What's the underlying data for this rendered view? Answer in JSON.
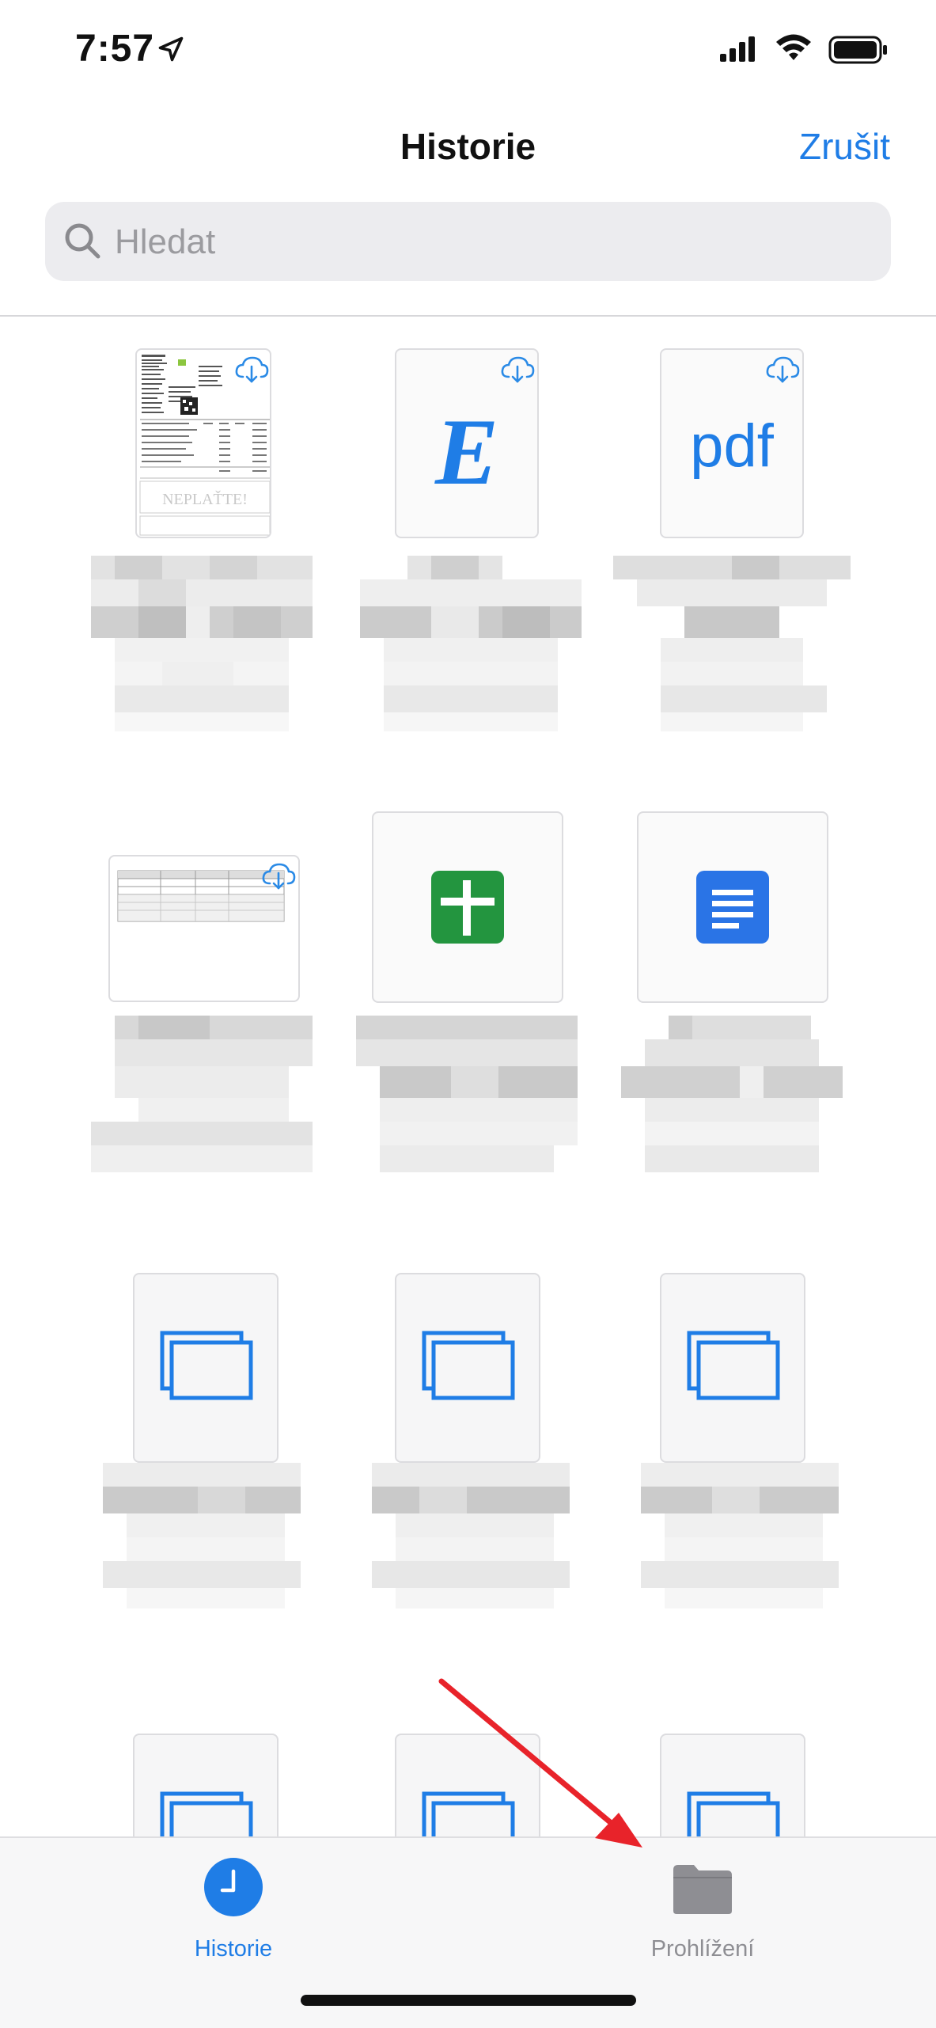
{
  "status_bar": {
    "time": "7:57"
  },
  "header": {
    "title": "Historie",
    "cancel_label": "Zrušit"
  },
  "search": {
    "placeholder": "Hledat"
  },
  "files": [
    {
      "kind": "invoice-pdf",
      "thumb_text": "NEPLAŤTE!"
    },
    {
      "kind": "e-doc",
      "thumb_text": "E"
    },
    {
      "kind": "pdf",
      "thumb_text": "pdf"
    },
    {
      "kind": "spreadsheet-preview",
      "thumb_text": ""
    },
    {
      "kind": "google-sheets",
      "thumb_text": ""
    },
    {
      "kind": "google-docs",
      "thumb_text": ""
    },
    {
      "kind": "keynote",
      "thumb_text": ""
    },
    {
      "kind": "keynote",
      "thumb_text": ""
    },
    {
      "kind": "keynote",
      "thumb_text": ""
    }
  ],
  "tabs": [
    {
      "label": "Historie",
      "icon": "clock-icon",
      "active": true
    },
    {
      "label": "Prohlížení",
      "icon": "folder-icon",
      "active": false
    }
  ],
  "colors": {
    "accent": "#1f7de6",
    "inactive": "#8e8e93",
    "sheets_green": "#23953f",
    "docs_blue": "#2a74e6",
    "arrow_red": "#e8232a"
  }
}
